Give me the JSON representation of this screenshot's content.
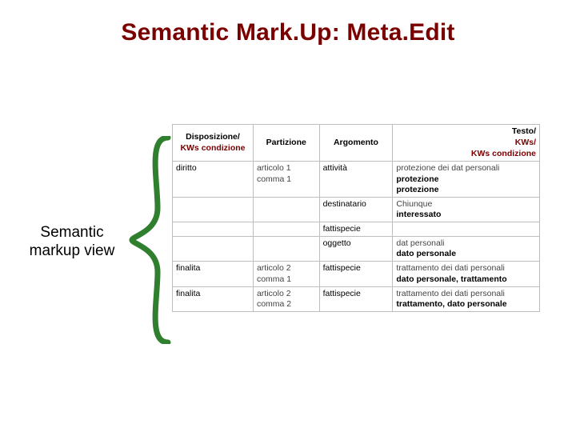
{
  "title": "Semantic Mark.Up: Meta.Edit",
  "caption_line1": "Semantic",
  "caption_line2": "markup view",
  "header": {
    "col1_main": "Disposizione/",
    "col1_sub": "KWs condizione",
    "col2": "Partizione",
    "col3": "Argomento",
    "col4_main": "Testo/",
    "col4_sub1": "KWs/",
    "col4_sub2": "KWs condizione"
  },
  "rows": [
    {
      "c1": "diritto",
      "c2a": "articolo 1",
      "c2b": "comma 1",
      "c3": "attività",
      "c4a": "protezione dei dat personali",
      "c4b": "protezione",
      "c4c": "protezione"
    },
    {
      "c1": "",
      "c2a": "",
      "c2b": "",
      "c3": "destinatario",
      "c4a": "Chiunque",
      "c4b": "interessato",
      "c4c": ""
    },
    {
      "c1": "",
      "c2a": "",
      "c2b": "",
      "c3": "fattispecie",
      "c4a": "",
      "c4b": "",
      "c4c": ""
    },
    {
      "c1": "",
      "c2a": "",
      "c2b": "",
      "c3": "oggetto",
      "c4a": "dat personali",
      "c4b": "dato personale",
      "c4c": ""
    },
    {
      "c1": "finalita",
      "c2a": "articolo 2",
      "c2b": "comma 1",
      "c3": "fattispecie",
      "c4a": "trattamento dei dati personali",
      "c4b": "dato personale, trattamento",
      "c4c": ""
    },
    {
      "c1": "finalita",
      "c2a": "articolo 2",
      "c2b": "comma 2",
      "c3": "fattispecie",
      "c4a": "trattamento dei dati personali",
      "c4b": "trattamento, dato personale",
      "c4c": ""
    }
  ]
}
